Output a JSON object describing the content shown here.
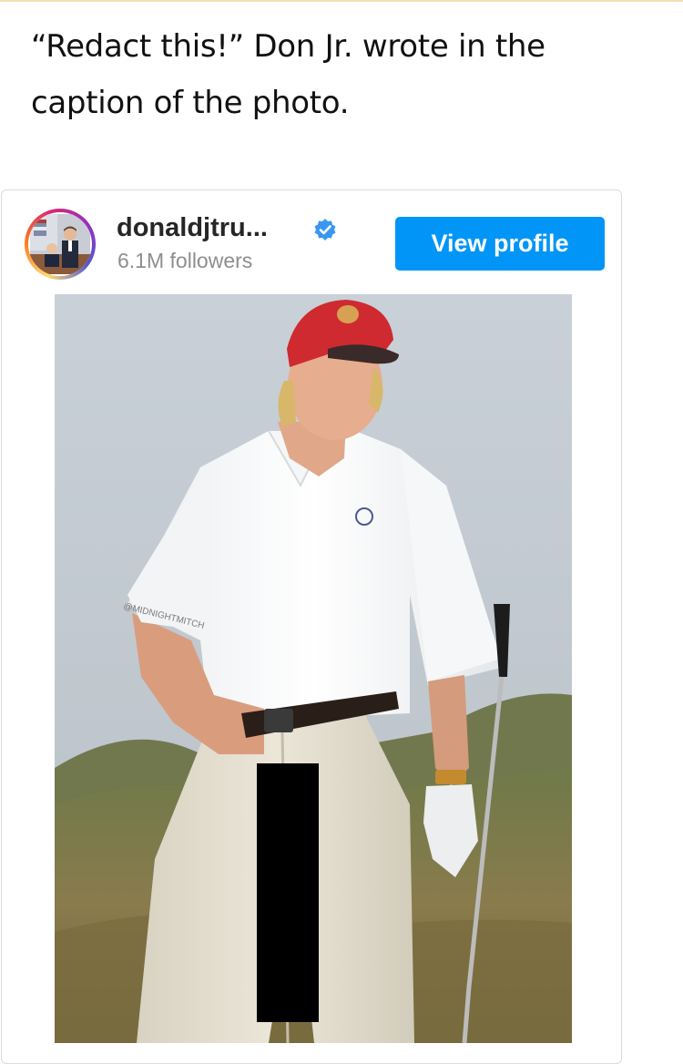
{
  "article": {
    "caption_text": "“Redact this!” Don Jr. wrote in the caption of the photo."
  },
  "embed": {
    "username": "donaldjtru...",
    "followers": "6.1M followers",
    "verified": true,
    "view_profile_label": "View profile",
    "accent_color": "#0095f6",
    "verified_color": "#3897f0"
  },
  "photo": {
    "watermark": "@MIDNIGHTMITCH"
  }
}
